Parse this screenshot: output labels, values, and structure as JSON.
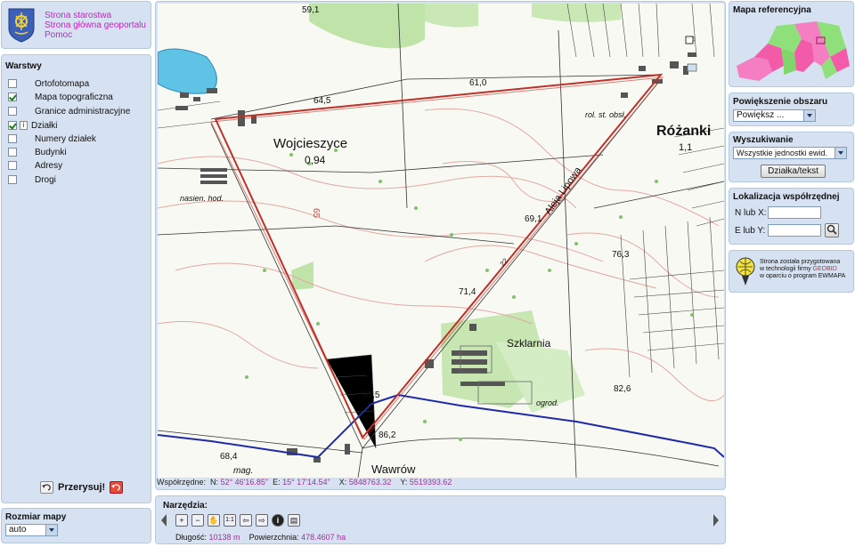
{
  "header": {
    "links": [
      "Strona starostwa",
      "Strona główna geoportalu",
      "Pomoc"
    ]
  },
  "layers": {
    "title": "Warstwy",
    "items": [
      {
        "label": "Ortofotomapa",
        "checked": false,
        "info": false
      },
      {
        "label": "Mapa topograficzna",
        "checked": true,
        "info": false
      },
      {
        "label": "Granice administracyjne",
        "checked": false,
        "info": false
      },
      {
        "label": "Działki",
        "checked": true,
        "info": true
      },
      {
        "label": "Numery działek",
        "checked": false,
        "info": false
      },
      {
        "label": "Budynki",
        "checked": false,
        "info": false
      },
      {
        "label": "Adresy",
        "checked": false,
        "info": false
      },
      {
        "label": "Drogi",
        "checked": false,
        "info": false
      }
    ],
    "info_glyph": "i",
    "refresh_label": "Przerysuj!"
  },
  "map_size": {
    "title": "Rozmiar mapy",
    "value": "auto"
  },
  "map": {
    "labels": {
      "town1": "Wojcieszyce",
      "town1_val": "0,94",
      "town2": "Różanki",
      "town2_val": "1,1",
      "town3": "Wawrów",
      "szklarnia": "Szklarnia",
      "aleja": "Aleja Lipowa",
      "rol": "rol. st. obsł.",
      "nasien": "nasien. hod.",
      "mag": "mag.",
      "ogrod": "ogrod.",
      "num_64_5": "64,5",
      "num_61_0": "61,0",
      "num_69_1": "69,1",
      "num_76_3": "76,3",
      "num_71_4": "71,4",
      "num_82_6": "82,6",
      "num_86_2": "86,2",
      "num_68_4": "68,4",
      "num_61_5": "61,5",
      "num_59_1": "59,1",
      "num_65": "65",
      "num_22": "22"
    }
  },
  "coords": {
    "prefix": "Współrzędne:",
    "n_label": "N:",
    "n_value": "52° 46'16.85\"",
    "e_label": "E:",
    "e_value": "15° 17'14.54\"",
    "x_label": "X:",
    "x_value": "5848763.32",
    "y_label": "Y:",
    "y_value": "5519393.62"
  },
  "tools": {
    "title": "Narzędzia:",
    "buttons": [
      {
        "icon": "zoom-in-icon",
        "glyph": "+"
      },
      {
        "icon": "zoom-out-icon",
        "glyph": "−"
      },
      {
        "icon": "pan-hand-icon",
        "glyph": "✋"
      },
      {
        "icon": "zoom-1-1-icon",
        "glyph": "1:1"
      },
      {
        "icon": "arrow-left-icon",
        "glyph": "⇦"
      },
      {
        "icon": "arrow-right-icon",
        "glyph": "⇨"
      },
      {
        "icon": "info-icon",
        "glyph": "i"
      },
      {
        "icon": "measure-icon",
        "glyph": "▤"
      }
    ],
    "length_label": "Długość:",
    "length_value": "10138 m",
    "area_label": "Powierzchnia:",
    "area_value": "478.4607 ha"
  },
  "reference": {
    "title": "Mapa referencyjna"
  },
  "zoom": {
    "title": "Powiększenie obszaru",
    "value": "Powiększ ..."
  },
  "search": {
    "title": "Wyszukiwanie",
    "value": "Wszystkie jednostki ewid.",
    "button": "Działka/tekst"
  },
  "coord_locate": {
    "title": "Lokalizacja współrzędnej",
    "n_label": "N lub X:",
    "e_label": "E lub Y:"
  },
  "geobid": {
    "line1": "Strona została przygotowana",
    "line2_prefix": "w technologii firmy",
    "brand": "GEOBID",
    "line3": "w oparciu o program EWMAPA"
  },
  "colors": {
    "panel_bg": "#d6e2f1",
    "link": "#c224c2",
    "measure_line": "#c0302a",
    "boundary_line": "#1f2aa8",
    "forest": "#bfe3a8"
  }
}
